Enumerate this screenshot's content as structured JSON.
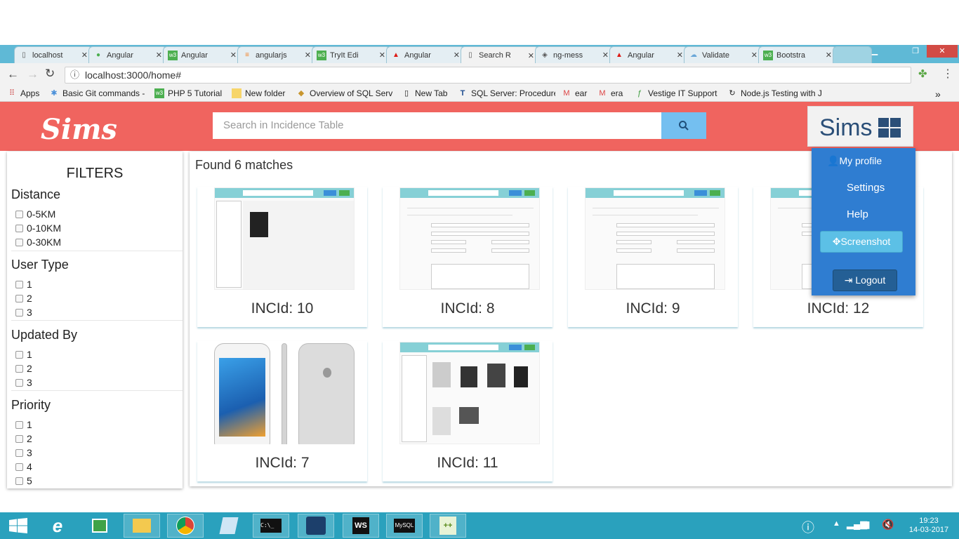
{
  "browser": {
    "tabs": [
      {
        "label": "localhost",
        "icon": "page-icon"
      },
      {
        "label": "Angular",
        "icon": "angular-green-icon"
      },
      {
        "label": "Angular",
        "icon": "w3-icon"
      },
      {
        "label": "angularjs",
        "icon": "stack-icon"
      },
      {
        "label": "TryIt Edi",
        "icon": "w3-icon"
      },
      {
        "label": "Angular",
        "icon": "angular-red-icon"
      },
      {
        "label": "Search R",
        "icon": "page-icon"
      },
      {
        "label": "ng-mess",
        "icon": "codepen-icon"
      },
      {
        "label": "Angular",
        "icon": "angular-red-icon"
      },
      {
        "label": "Validate",
        "icon": "cloud-icon"
      },
      {
        "label": "Bootstra",
        "icon": "w3-icon"
      }
    ],
    "url": "localhost:3000/home#",
    "bookmarks": [
      {
        "label": "Apps"
      },
      {
        "label": "Basic Git commands -"
      },
      {
        "label": "PHP 5 Tutorial"
      },
      {
        "label": "New folder"
      },
      {
        "label": "Overview of SQL Serv"
      },
      {
        "label": "New Tab"
      },
      {
        "label": "SQL Server: Procedure"
      },
      {
        "label": "ear"
      },
      {
        "label": "era"
      },
      {
        "label": "Vestige IT Support"
      },
      {
        "label": "Node.js Testing with J"
      }
    ],
    "overflow_label": "»"
  },
  "header": {
    "logo": "Sims",
    "search_placeholder": "Search in Incidence Table",
    "brand": "Sims"
  },
  "filters": {
    "title": "FILTERS",
    "groups": [
      {
        "title": "Distance",
        "options": [
          "0-5KM",
          "0-10KM",
          "0-30KM"
        ]
      },
      {
        "title": "User Type",
        "options": [
          "1",
          "2",
          "3"
        ]
      },
      {
        "title": "Updated By",
        "options": [
          "1",
          "2",
          "3"
        ]
      },
      {
        "title": "Priority",
        "options": [
          "1",
          "2",
          "3",
          "4",
          "5"
        ]
      }
    ]
  },
  "results": {
    "summary": "Found 6 matches",
    "cards": [
      {
        "caption": "INCId: 10"
      },
      {
        "caption": "INCId: 8"
      },
      {
        "caption": "INCId: 9"
      },
      {
        "caption": "INCId: 12"
      },
      {
        "caption": "INCId: 7"
      },
      {
        "caption": "INCId: 11"
      }
    ]
  },
  "user_menu": {
    "profile": "My profile",
    "settings": "Settings",
    "help": "Help",
    "screenshot": "Screenshot",
    "logout": "Logout"
  },
  "taskbar": {
    "time": "19:23",
    "date": "14-03-2017"
  },
  "colors": {
    "header": "#f0645f",
    "menu": "#2f7dd1",
    "taskbar": "#2aa1bd",
    "tabbar": "#5fb9d6"
  }
}
